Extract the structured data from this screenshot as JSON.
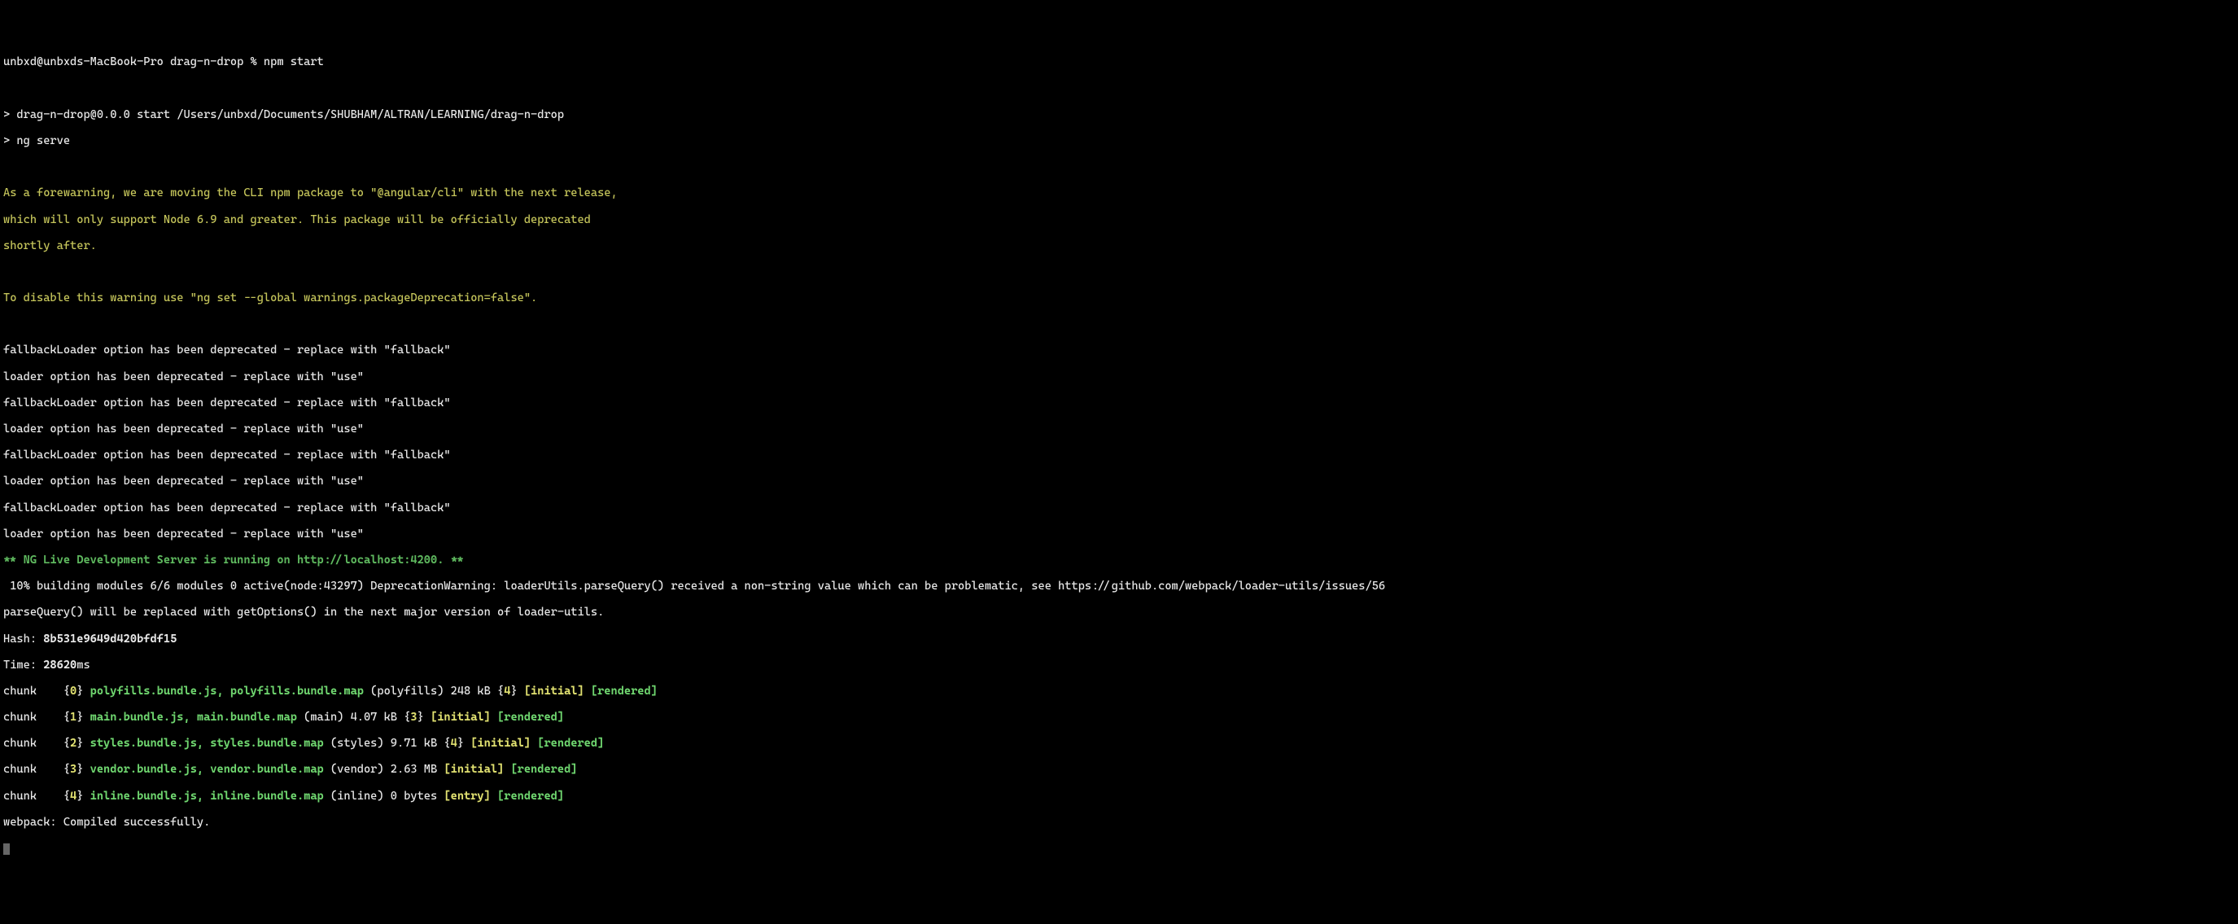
{
  "prompt": {
    "user_host": "unbxd@unbxds-MacBook-Pro",
    "dir": "drag-n-drop",
    "symbol": "%",
    "command": "npm start"
  },
  "npm_run": {
    "line1": "> drag-n-drop@0.0.0 start /Users/unbxd/Documents/SHUBHAM/ALTRAN/LEARNING/drag-n-drop",
    "line2": "> ng serve"
  },
  "forewarning": {
    "l1": "As a forewarning, we are moving the CLI npm package to \"@angular/cli\" with the next release,",
    "l2": "which will only support Node 6.9 and greater. This package will be officially deprecated",
    "l3": "shortly after.",
    "l4": "To disable this warning use \"ng set --global warnings.packageDeprecation=false\"."
  },
  "deprecations": {
    "fallback": "fallbackLoader option has been deprecated - replace with \"fallback\"",
    "loader": "loader option has been deprecated - replace with \"use\""
  },
  "ng_live": "** NG Live Development Server is running on http://localhost:4200. **",
  "building": " 10% building modules 6/6 modules 0 active(node:43297) DeprecationWarning: loaderUtils.parseQuery() received a non-string value which can be problematic, see https://github.com/webpack/loader-utils/issues/56",
  "parsequery": "parseQuery() will be replaced with getOptions() in the next major version of loader-utils.",
  "hash": {
    "label": "Hash: ",
    "value": "8b531e9649d420bfdf15"
  },
  "time": {
    "label": "Time: ",
    "value": "28620",
    "unit": "ms"
  },
  "chunks": [
    {
      "prefix": "chunk    {",
      "num": "0",
      "close": "} ",
      "files": "polyfills.bundle.js, polyfills.bundle.map",
      "meta": " (polyfills) 248 kB {",
      "dep": "4",
      "depclose": "} ",
      "initial": "[initial]",
      "rendered": " [rendered]"
    },
    {
      "prefix": "chunk    {",
      "num": "1",
      "close": "} ",
      "files": "main.bundle.js, main.bundle.map",
      "meta": " (main) 4.07 kB {",
      "dep": "3",
      "depclose": "} ",
      "initial": "[initial]",
      "rendered": " [rendered]"
    },
    {
      "prefix": "chunk    {",
      "num": "2",
      "close": "} ",
      "files": "styles.bundle.js, styles.bundle.map",
      "meta": " (styles) 9.71 kB {",
      "dep": "4",
      "depclose": "} ",
      "initial": "[initial]",
      "rendered": " [rendered]"
    },
    {
      "prefix": "chunk    {",
      "num": "3",
      "close": "} ",
      "files": "vendor.bundle.js, vendor.bundle.map",
      "meta": " (vendor) 2.63 MB ",
      "dep": "",
      "depclose": "",
      "initial": "[initial]",
      "rendered": " [rendered]"
    },
    {
      "prefix": "chunk    {",
      "num": "4",
      "close": "} ",
      "files": "inline.bundle.js, inline.bundle.map",
      "meta": " (inline) 0 bytes ",
      "dep": "",
      "depclose": "",
      "initial": "[entry]",
      "rendered": " [rendered]"
    }
  ],
  "webpack": "webpack: Compiled successfully."
}
